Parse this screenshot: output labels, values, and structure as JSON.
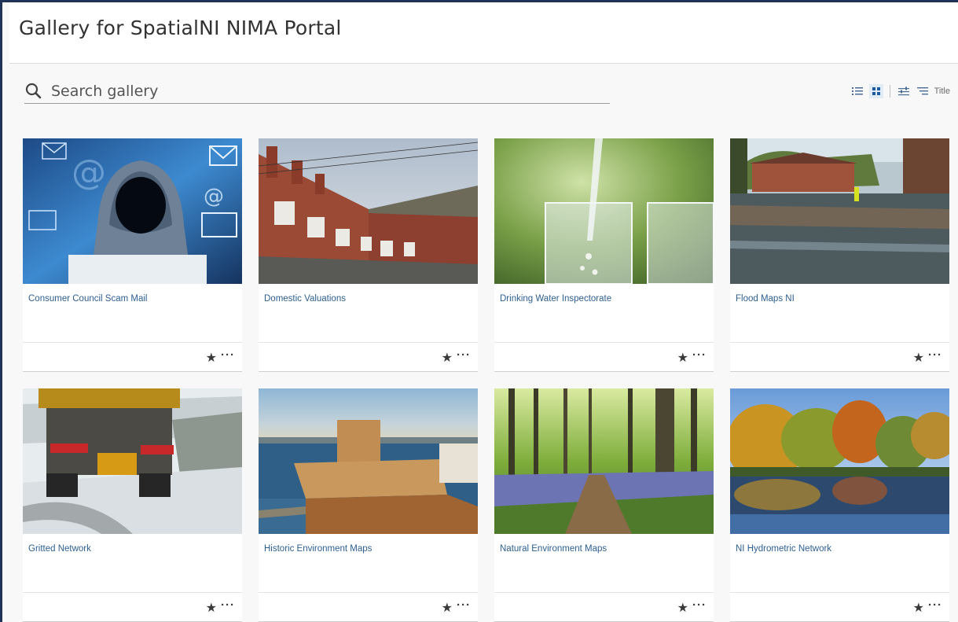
{
  "header": {
    "title": "Gallery for SpatialNI NIMA Portal"
  },
  "search": {
    "placeholder": "Search gallery",
    "icon": "search-icon"
  },
  "toolbar": {
    "list_view_icon": "list-view-icon",
    "grid_view_icon": "grid-view-icon",
    "filter_icon": "filter-icon",
    "sort_icon": "sort-icon",
    "sort_label": "Title",
    "active_view": "grid"
  },
  "colors": {
    "accent": "#1e3357",
    "title_link": "#2d5f8f",
    "active_view_bg": "#e2ecf7"
  },
  "cards": [
    {
      "title": "Consumer Council Scam Mail",
      "thumb": "hacker-laptop-email-image"
    },
    {
      "title": "Domestic Valuations",
      "thumb": "terraced-houses-image"
    },
    {
      "title": "Drinking Water Inspectorate",
      "thumb": "water-glass-image"
    },
    {
      "title": "Flood Maps NI",
      "thumb": "flooded-street-image"
    },
    {
      "title": "Gritted Network",
      "thumb": "gritting-truck-snow-image"
    },
    {
      "title": "Historic Environment Maps",
      "thumb": "castle-harbour-image"
    },
    {
      "title": "Natural Environment Maps",
      "thumb": "bluebell-woodland-path-image"
    },
    {
      "title": "NI Hydrometric Network",
      "thumb": "autumn-river-image"
    }
  ],
  "card_actions": {
    "favorite_icon": "star-icon",
    "more_icon": "ellipsis-icon"
  }
}
